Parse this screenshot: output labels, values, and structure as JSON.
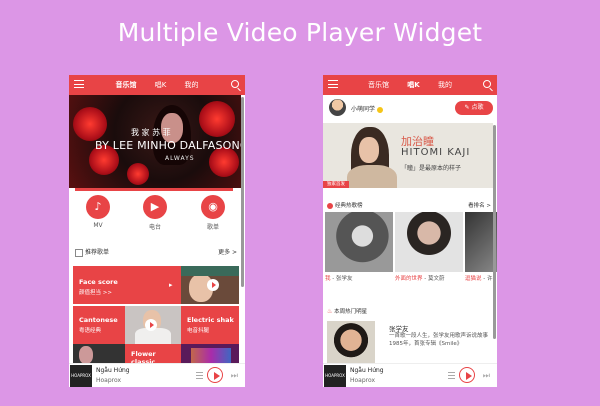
{
  "page": {
    "title": "Multiple Video Player Widget"
  },
  "phone1": {
    "tabs": [
      "音乐馆",
      "唱K",
      "我的"
    ],
    "active_tab": 0,
    "banner": {
      "cn_title": "我 家 苏 菲",
      "en_title": "BY LEE MINHO DALFASONG",
      "sub": "ALWAYS"
    },
    "quick_links": [
      {
        "icon": "music-note-icon",
        "label": "MV"
      },
      {
        "icon": "video-icon",
        "label": "电台"
      },
      {
        "icon": "radio-icon",
        "label": "歌单"
      }
    ],
    "section": {
      "title": "推荐歌单",
      "more": "更多 >"
    },
    "tiles": [
      {
        "title": "Face score",
        "subtitle": "颜值担当 >>"
      },
      {
        "title": "Cantonese",
        "subtitle": "粤语经典"
      },
      {
        "title": "Electric shak",
        "subtitle": "电音抖腿"
      },
      {
        "title": "Flower classic",
        "subtitle": ""
      }
    ],
    "player": {
      "song": "Ngẫu Hứng",
      "artist": "Hoaprox",
      "album_text": "HOAPROX"
    }
  },
  "phone2": {
    "tabs": [
      "音乐馆",
      "唱K",
      "我的"
    ],
    "active_tab": 1,
    "user": {
      "name": "小萌同学",
      "button": "✎ 点歌"
    },
    "banner": {
      "cn_title": "加治瞳",
      "en_title": "HITOMI KAJI",
      "sub": "「瞳」是最原本的样子",
      "tag": "独家首发"
    },
    "section_classic": {
      "title": "经典热歌榜",
      "more": "看排名 >"
    },
    "covers": [
      {
        "song": "我",
        "artist": " - 张学友"
      },
      {
        "song": "外面的世界",
        "artist": " - 莫文蔚"
      },
      {
        "song": "逗猫说",
        "artist": " - 许"
      }
    ],
    "section_artists": {
      "title": "本周热门明星"
    },
    "featured_artist": {
      "name": "张学友",
      "desc": "一首歌一段人生，张学友用歌声诉说故事 1985年，首张专辑《Smile》"
    },
    "player": {
      "song": "Ngẫu Hứng",
      "artist": "Hoaprox",
      "album_text": "HOAPROX"
    }
  },
  "colors": {
    "background": "#dc96e6",
    "accent": "#e84446"
  }
}
